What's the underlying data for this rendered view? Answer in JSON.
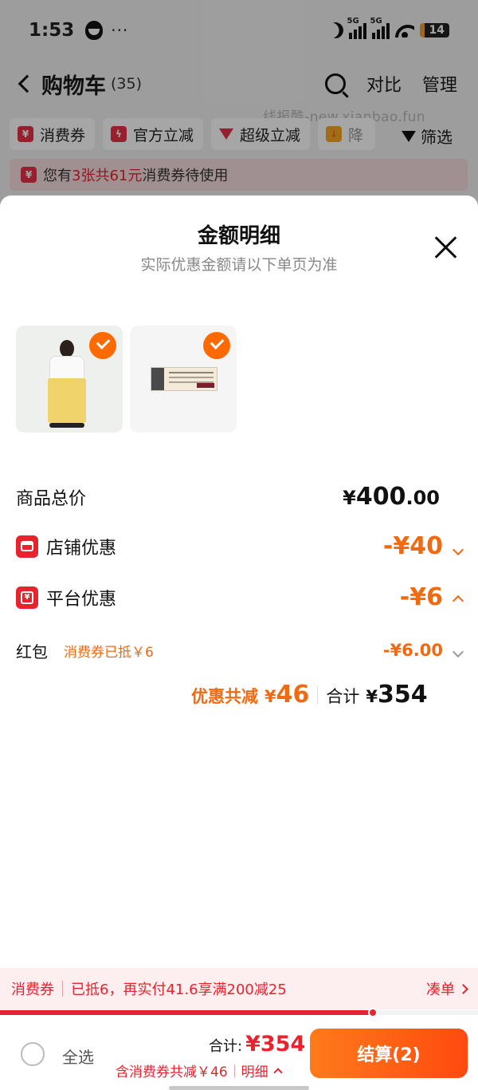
{
  "status_bar": {
    "time": "1:53",
    "dots": "···",
    "net1": "5G",
    "net2": "5G",
    "battery": "14"
  },
  "header": {
    "title": "购物车",
    "count": "(35)",
    "compare": "对比",
    "manage": "管理"
  },
  "watermark": "线报酷-new.xianbao.fun",
  "filters": {
    "chips": [
      {
        "label": "消费券",
        "icon": "coupon-icon"
      },
      {
        "label": "官方立减",
        "icon": "flash-icon"
      },
      {
        "label": "超级立减",
        "icon": "arrow-down-icon"
      },
      {
        "label": "降",
        "icon": "price-drop-icon"
      }
    ],
    "filter_label": "筛选"
  },
  "coupon_banner": {
    "pre": "您有",
    "highlight": "3张共61元",
    "post": "消费券待使用"
  },
  "sheet": {
    "title": "金额明细",
    "subtitle": "实际优惠金额请以下单页为准",
    "items": [
      {
        "name": "yellow-pants-outfit",
        "checked": true
      },
      {
        "name": "plastic-eraser",
        "checked": true
      }
    ],
    "total_price": {
      "label": "商品总价",
      "yen": "¥",
      "main": "400",
      "cents": ".00"
    },
    "store_discount": {
      "label": "店铺优惠",
      "value": "-¥40"
    },
    "platform_discount": {
      "label": "平台优惠",
      "value": "-¥6"
    },
    "red_packet": {
      "label": "红包",
      "note": "消费券已抵￥6",
      "value": "-¥6.00"
    },
    "summary": {
      "saved_label": "优惠共减",
      "saved_yen": "¥",
      "saved_value": "46",
      "total_label": "合计",
      "total_yen": "¥",
      "total_value": "354"
    }
  },
  "coupon_strip": {
    "label": "消费券",
    "text": "已抵6，再实付41.6享满200减25",
    "action": "凑单",
    "progress": 0.78
  },
  "checkout": {
    "select_all": "全选",
    "total_label": "合计:",
    "total_value": "¥354",
    "include_text": "含消费券共减￥46",
    "detail_label": "明细",
    "pay_button": "结算(2)"
  },
  "colors": {
    "accent": "#e8232e",
    "orange": "#f06a12",
    "pay": "#ff5a14",
    "check": "#ff6a00"
  }
}
